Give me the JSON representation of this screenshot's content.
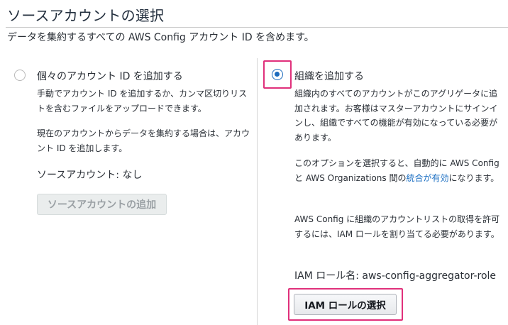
{
  "header": {
    "title": "ソースアカウントの選択",
    "subtitle": "データを集約するすべての AWS Config アカウント ID を含めます。"
  },
  "left_option": {
    "label": "個々のアカウント ID を追加する",
    "selected": false,
    "description_1": "手動でアカウント ID を追加するか、カンマ区切りリストを含むファイルをアップロードできます。",
    "description_2": "現在のアカウントからデータを集約する場合は、アカウント ID を追加します。",
    "source_accounts": "ソースアカウント: なし",
    "add_button_label": "ソースアカウントの追加"
  },
  "right_option": {
    "label": "組織を追加する",
    "selected": true,
    "description_1": "組織内のすべてのアカウントがこのアグリゲータに追加されます。お客様はマスターアカウントにサインインし、組織ですべての機能が有効になっている必要があります。",
    "description_2_prefix": "このオプションを選択すると、自動的に AWS Config と AWS Organizations 間の",
    "description_2_link": "統合が有効",
    "description_2_suffix": "になります。",
    "description_3": "AWS Config に組織のアカウントリストの取得を許可するには、IAM ロールを割り当てる必要があります。",
    "iam_role": "IAM ロール名: aws-config-aggregator-role",
    "select_role_button_label": "IAM ロールの選択"
  },
  "colors": {
    "accent": "#1d6bbd",
    "link": "#1a6ec2",
    "highlight": "#e0307b"
  }
}
